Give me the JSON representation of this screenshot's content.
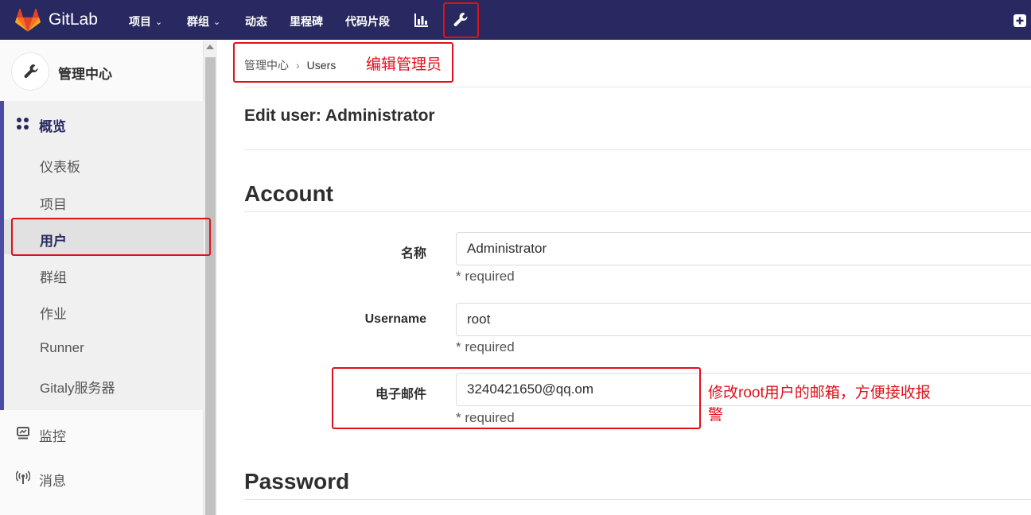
{
  "navbar": {
    "brand": "GitLab",
    "items": [
      {
        "label": "项目",
        "dropdown": true
      },
      {
        "label": "群组",
        "dropdown": true
      },
      {
        "label": "动态"
      },
      {
        "label": "里程碑"
      },
      {
        "label": "代码片段"
      }
    ],
    "icons": [
      "tanuki-logo-icon",
      "activity-chart-icon",
      "admin-wrench-icon",
      "plus-square-icon"
    ],
    "colors": {
      "background": "#292961",
      "logo_orange": "#fc6d26"
    }
  },
  "sidebar": {
    "context_title": "管理中心",
    "overview": {
      "label": "概览",
      "items": [
        {
          "label": "仪表板"
        },
        {
          "label": "项目"
        },
        {
          "label": "用户",
          "active": true
        },
        {
          "label": "群组"
        },
        {
          "label": "作业"
        },
        {
          "label": "Runner"
        },
        {
          "label": "Gitaly服务器"
        }
      ]
    },
    "monitoring": {
      "label": "监控"
    },
    "messages": {
      "label": "消息"
    }
  },
  "breadcrumb": {
    "parent": "管理中心",
    "current": "Users"
  },
  "annotations": {
    "breadcrumb_note": "编辑管理员",
    "email_note_line1": "修改root用户的邮箱，方便接收报",
    "email_note_line2": "警",
    "color": "#e0101a"
  },
  "main": {
    "page_title": "Edit user: Administrator",
    "account_section": "Account",
    "password_section": "Password",
    "fields": {
      "name": {
        "label": "名称",
        "value": "Administrator",
        "hint": "* required"
      },
      "username": {
        "label": "Username",
        "value": "root",
        "hint": "* required"
      },
      "email": {
        "label": "电子邮件",
        "value": "3240421650@qq.om",
        "hint": "* required"
      }
    }
  }
}
